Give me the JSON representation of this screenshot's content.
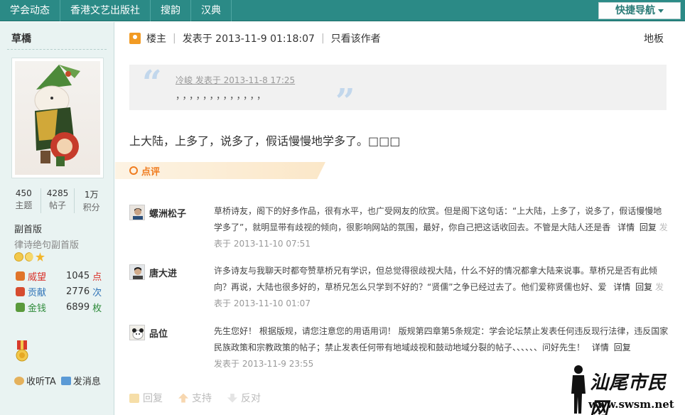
{
  "nav": {
    "items": [
      "学会动态",
      "香港文艺出版社",
      "搜韵",
      "汉典"
    ],
    "quick_nav": "快捷导航"
  },
  "profile": {
    "username": "草橋",
    "stats": [
      {
        "value": "450",
        "label": "主题"
      },
      {
        "value": "4285",
        "label": "帖子"
      },
      {
        "value": "1万",
        "label": "积分"
      }
    ],
    "rank": "副首版",
    "rank_title": "律诗绝句副首版",
    "metrics": [
      {
        "name": "威望",
        "value": "1045",
        "unit": "点",
        "color": "#e0742a",
        "unit_color": "#d9322b"
      },
      {
        "name": "贡献",
        "value": "2776",
        "unit": "次",
        "color": "#d64c2f",
        "unit_color": "#2f73b7"
      },
      {
        "name": "金钱",
        "value": "6899",
        "unit": "枚",
        "color": "#5a9a3c",
        "unit_color": "#2e8b3a"
      }
    ],
    "follow_label": "收听TA",
    "message_label": "发消息"
  },
  "post": {
    "author_label": "楼主",
    "posted": "发表于 2013-11-9 01:18:07",
    "author_only": "只看该作者",
    "floor": "地板",
    "quote": {
      "header": "冷峻 发表于 2013-11-8 17:25",
      "body": "，，，，，，，，，，，，，"
    },
    "content": "上大陆，上多了，说多了，假话慢慢地学多了。□□□",
    "comments_tab": "点评",
    "comments": [
      {
        "name": "螺洲松子",
        "text": "草桥诗友，阁下的好多作品，很有水平，也广受网友的欣赏。但是阁下这句话：“上大陆，上多了，说多了，假话慢慢地学多了”，就明显带有歧视的倾向，很影响网站的氛围，最好，你自己把这话收回去。不管是大陆人还是香",
        "detail": "详情",
        "reply": "回复",
        "fade": "发",
        "time": "表于 2013-11-10 07:51"
      },
      {
        "name": "唐大进",
        "text": "许多诗友与我聊天时都夸赞草桥兄有学识，但总觉得很歧视大陆，什么不好的情况都拿大陆来说事。草桥兄是否有此倾向？再说，大陆也很多好的，草桥兄怎么只学到不好的？“贤儒”之争已经过去了。他们爱称贤儒也好、爱",
        "detail": "详情",
        "reply": "回复",
        "fade": "发",
        "time": "表于 2013-11-10 01:07"
      },
      {
        "name": "品位",
        "text": "先生您好！ 根据版规，请您注意您的用语用词！ 版规第四章第5条规定：学会论坛禁止发表任何违反现行法律，违反国家民族政策和宗教政策的帖子；禁止发表任何带有地域歧视和鼓动地域分裂的帖子、、、、、、问好先生！",
        "detail": "详情",
        "reply": "回复",
        "fade": "",
        "time": "发表于 2013-11-9 23:55"
      }
    ],
    "actions": [
      "回复",
      "支持",
      "反对"
    ]
  },
  "watermark": {
    "title": "汕尾市民网",
    "url": "www.swsm.net"
  }
}
